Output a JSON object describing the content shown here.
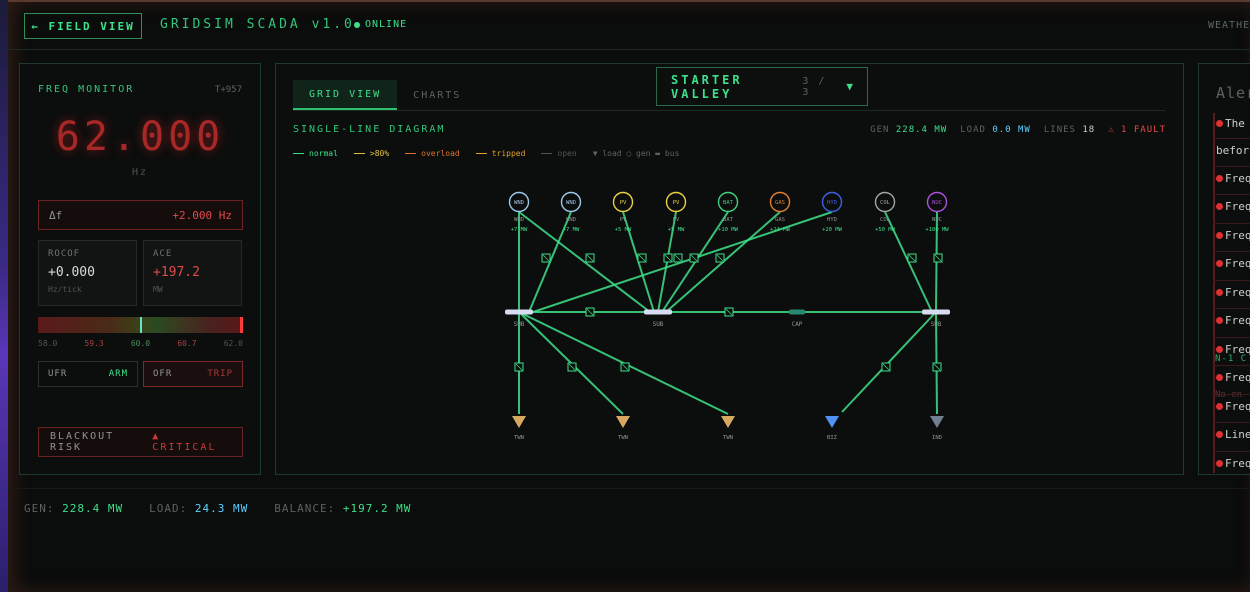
{
  "header": {
    "back_label": "← FIELD VIEW",
    "brand": "GRIDSIM SCADA v1.0",
    "status": "ONLINE",
    "weather_label": "WEATHER"
  },
  "freq_monitor": {
    "title": "FREQ MONITOR",
    "tick": "T+957",
    "frequency": "62.000",
    "unit": "Hz",
    "delta_label": "Δf",
    "delta_value": "+2.000 Hz",
    "rocof": {
      "label": "ROCOF",
      "value": "+0.000",
      "unit": "Hz/tick"
    },
    "ace": {
      "label": "ACE",
      "value": "+197.2",
      "unit": "MW"
    },
    "gauge_fraction": 0.5,
    "scale": [
      "58.0",
      "59.3",
      "60.0",
      "60.7",
      "62.0"
    ],
    "ufr": {
      "label": "UFR",
      "state": "ARM"
    },
    "ofr": {
      "label": "OFR",
      "state": "TRIP"
    },
    "blackout": {
      "label": "BLACKOUT RISK",
      "value": "▲ CRITICAL"
    }
  },
  "grid_view": {
    "tabs": [
      {
        "label": "GRID VIEW",
        "active": true
      },
      {
        "label": "CHARTS",
        "active": false
      }
    ],
    "scenario": {
      "name": "STARTER VALLEY",
      "index": "3 / 3",
      "caret": "▼"
    },
    "diagram_title": "SINGLE-LINE DIAGRAM",
    "stats": {
      "gen_label": "GEN",
      "gen_value": "228.4 MW",
      "load_label": "LOAD",
      "load_value": "0.0 MW",
      "lines_label": "LINES",
      "lines_value": "18",
      "fault": "⚠ 1 FAULT"
    },
    "legend": [
      {
        "label": "normal",
        "color": "#3ee08a",
        "line": true
      },
      {
        "label": ">80%",
        "color": "#e0c040",
        "line": true
      },
      {
        "label": "overload",
        "color": "#e07030",
        "line": true
      },
      {
        "label": "tripped",
        "color": "#e0a030",
        "line": true
      },
      {
        "label": "open",
        "color": "#4e5551",
        "line": true
      },
      {
        "label": "▼ load ○ gen ▬ bus",
        "color": "#5b635e",
        "line": false
      }
    ],
    "generators": [
      {
        "code": "WND",
        "label": "WND",
        "mw": "+7 MW",
        "color": "#9ec8e8"
      },
      {
        "code": "WND",
        "label": "WND",
        "mw": "+7 MW",
        "color": "#9ec8e8"
      },
      {
        "code": "PV",
        "label": "PV",
        "mw": "+5 MW",
        "color": "#e8d040"
      },
      {
        "code": "PV",
        "label": "PV",
        "mw": "+5 MW",
        "color": "#e8d040"
      },
      {
        "code": "BAT",
        "label": "BAT",
        "mw": "+10 MW",
        "color": "#40d080"
      },
      {
        "code": "GAS",
        "label": "GAS",
        "mw": "+24 MW",
        "color": "#e08030"
      },
      {
        "code": "HYD",
        "label": "HYD",
        "mw": "+20 MW",
        "color": "#4060e0"
      },
      {
        "code": "COL",
        "label": "COL",
        "mw": "+50 MW",
        "color": "#a0a8a4"
      },
      {
        "code": "NUC",
        "label": "NUC",
        "mw": "+100 MW",
        "color": "#b050e0"
      }
    ],
    "buses": [
      "SUB",
      "SUB",
      "CAP",
      "SUB"
    ],
    "loads": [
      {
        "label": "TWN",
        "color": "#d8a860"
      },
      {
        "label": "TWN",
        "color": "#d8a860"
      },
      {
        "label": "TWN",
        "color": "#d8a860"
      },
      {
        "label": "BIZ",
        "color": "#5090f0"
      },
      {
        "label": "IND",
        "color": "#708090"
      }
    ]
  },
  "alerts": {
    "title": "Alerts",
    "items": [
      "The",
      "befor",
      "Freq",
      "Freq",
      "Freq",
      "Freq",
      "Freq",
      "Freq",
      "Freq",
      "Freq",
      "Freq",
      "Line",
      "Freq"
    ],
    "n1_label": "N-1 C",
    "no_events": "No en"
  },
  "footer": {
    "gen_label": "GEN:",
    "gen_value": "228.4 MW",
    "load_label": "LOAD:",
    "load_value": "24.3 MW",
    "balance_label": "BALANCE:",
    "balance_value": "+197.2 MW"
  },
  "colors": {
    "accent": "#3ee08a",
    "critical": "#e24a4a",
    "cyan": "#5fd0ff"
  }
}
